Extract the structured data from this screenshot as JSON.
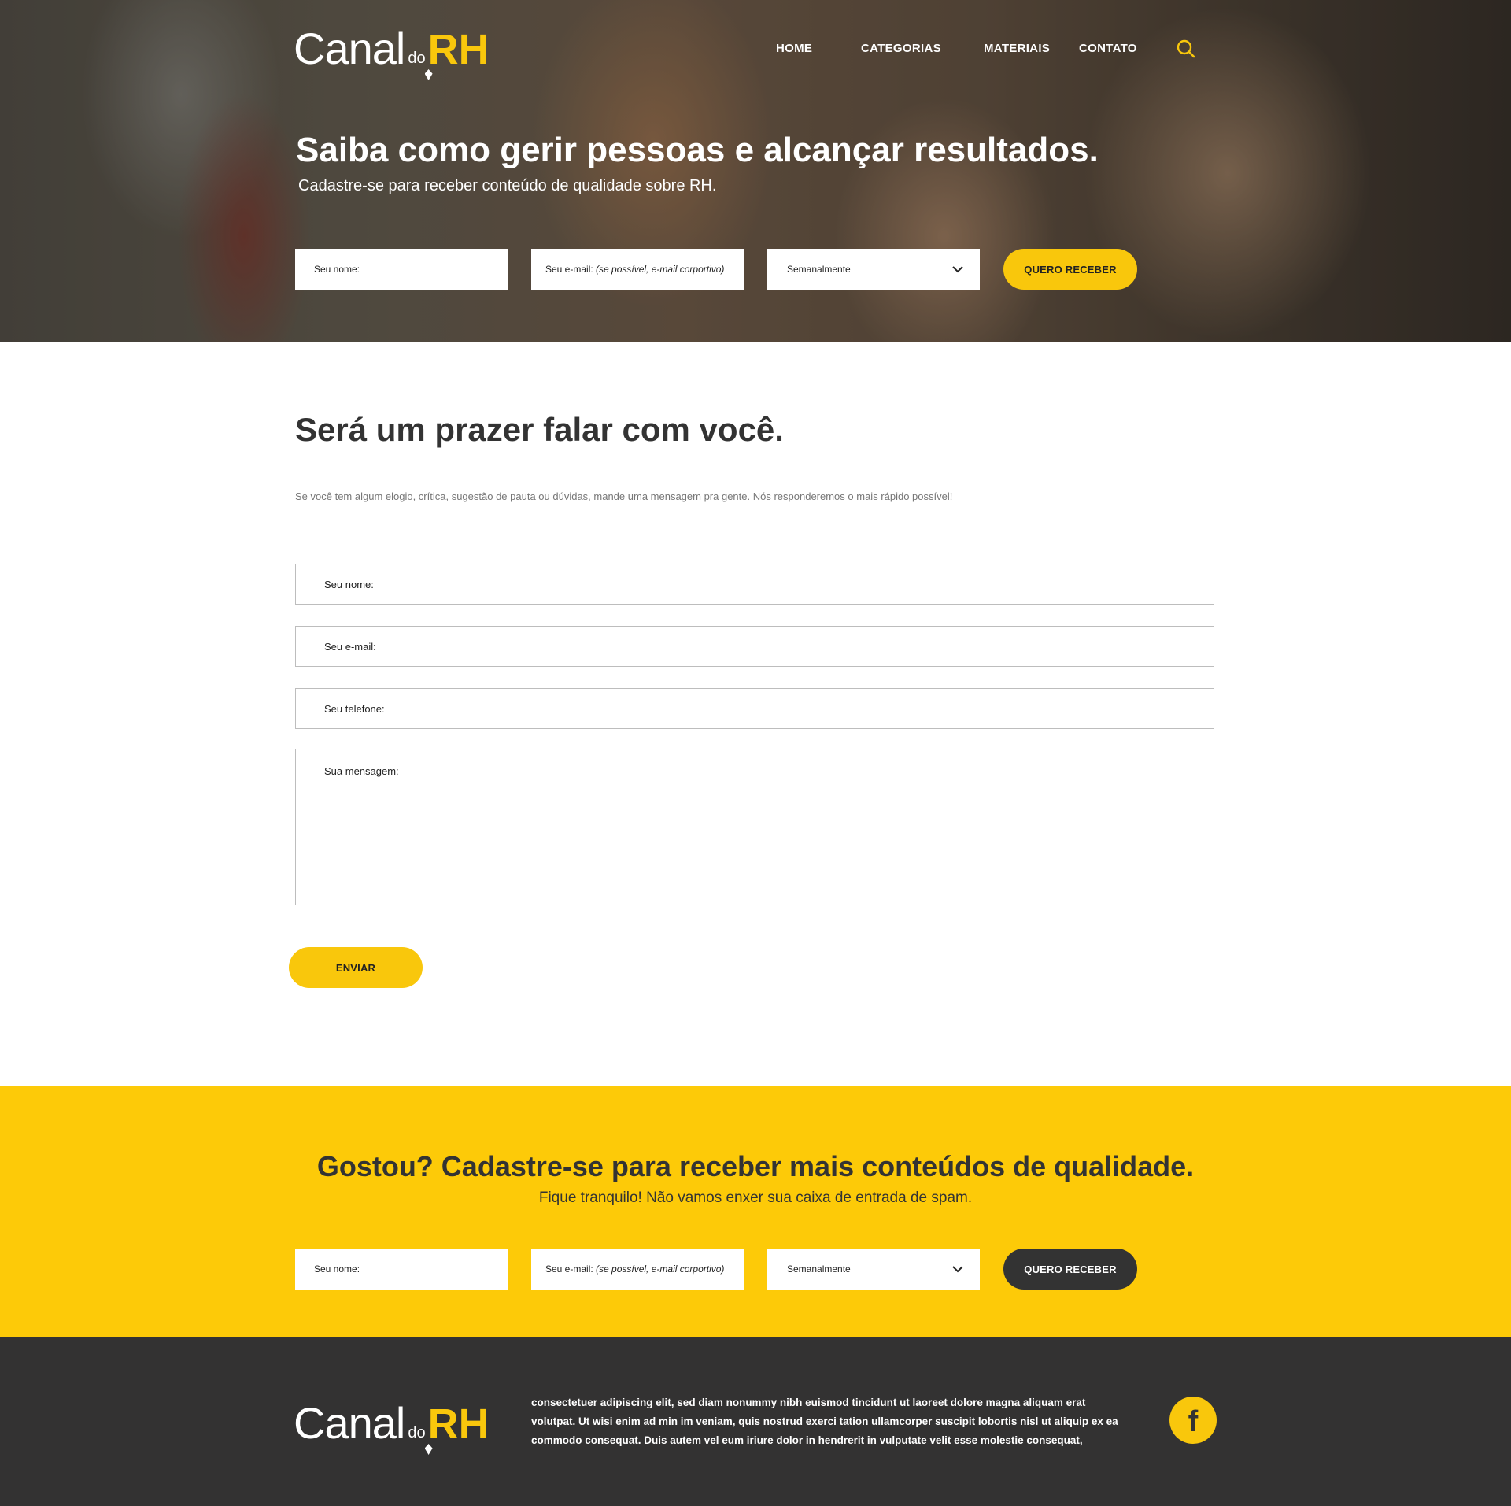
{
  "brand": {
    "canal": "Canal",
    "do": "do",
    "rh": "RH"
  },
  "nav": {
    "home": "HOME",
    "categorias": "CATEGORIAS",
    "materiais": "MATERIAIS",
    "contato": "CONTATO"
  },
  "hero": {
    "title_part1": "Saiba como ",
    "title_bold1": "gerir pessoas",
    "title_part2": " e ",
    "title_bold2": "alcançar resultados",
    "title_part3": ".",
    "subtitle": "Cadastre-se para receber conteúdo de qualidade sobre RH."
  },
  "signup": {
    "name_placeholder": "Seu nome:",
    "email_placeholder": "Seu e-mail: ",
    "email_hint": "(se possível, e-mail corportivo)",
    "frequency_selected": "Semanalmente",
    "submit_label": "QUERO RECEBER"
  },
  "contact": {
    "title": "Será um prazer falar com você.",
    "description": "Se você tem algum elogio, crítica, sugestão de pauta ou dúvidas, mande uma mensagem pra gente. Nós responderemos o mais rápido possível!",
    "name_placeholder": "Seu nome:",
    "email_placeholder": "Seu e-mail:",
    "phone_placeholder": "Seu telefone:",
    "message_placeholder": "Sua mensagem:",
    "submit_label": "ENVIAR"
  },
  "band": {
    "title": "Gostou? Cadastre-se para receber mais conteúdos de qualidade.",
    "subtitle": "Fique tranquilo! Não vamos enxer sua caixa de entrada de spam."
  },
  "footer": {
    "text": "consectetuer adipiscing elit, sed diam nonummy nibh euismod tincidunt ut laoreet dolore magna aliquam erat volutpat. Ut wisi enim ad min im veniam, quis nostrud exerci tation ullamcorper suscipit lobortis nisl ut aliquip ex ea commodo consequat. Duis autem vel eum iriure dolor in hendrerit in vulputate velit esse molestie consequat,",
    "facebook_glyph": "f"
  },
  "colors": {
    "accent": "#f9c70c",
    "band": "#fdca08",
    "dark": "#333232",
    "text": "#333333"
  },
  "icons": {
    "search": "search-icon",
    "chevron": "chevron-down-icon",
    "facebook": "facebook-icon"
  }
}
